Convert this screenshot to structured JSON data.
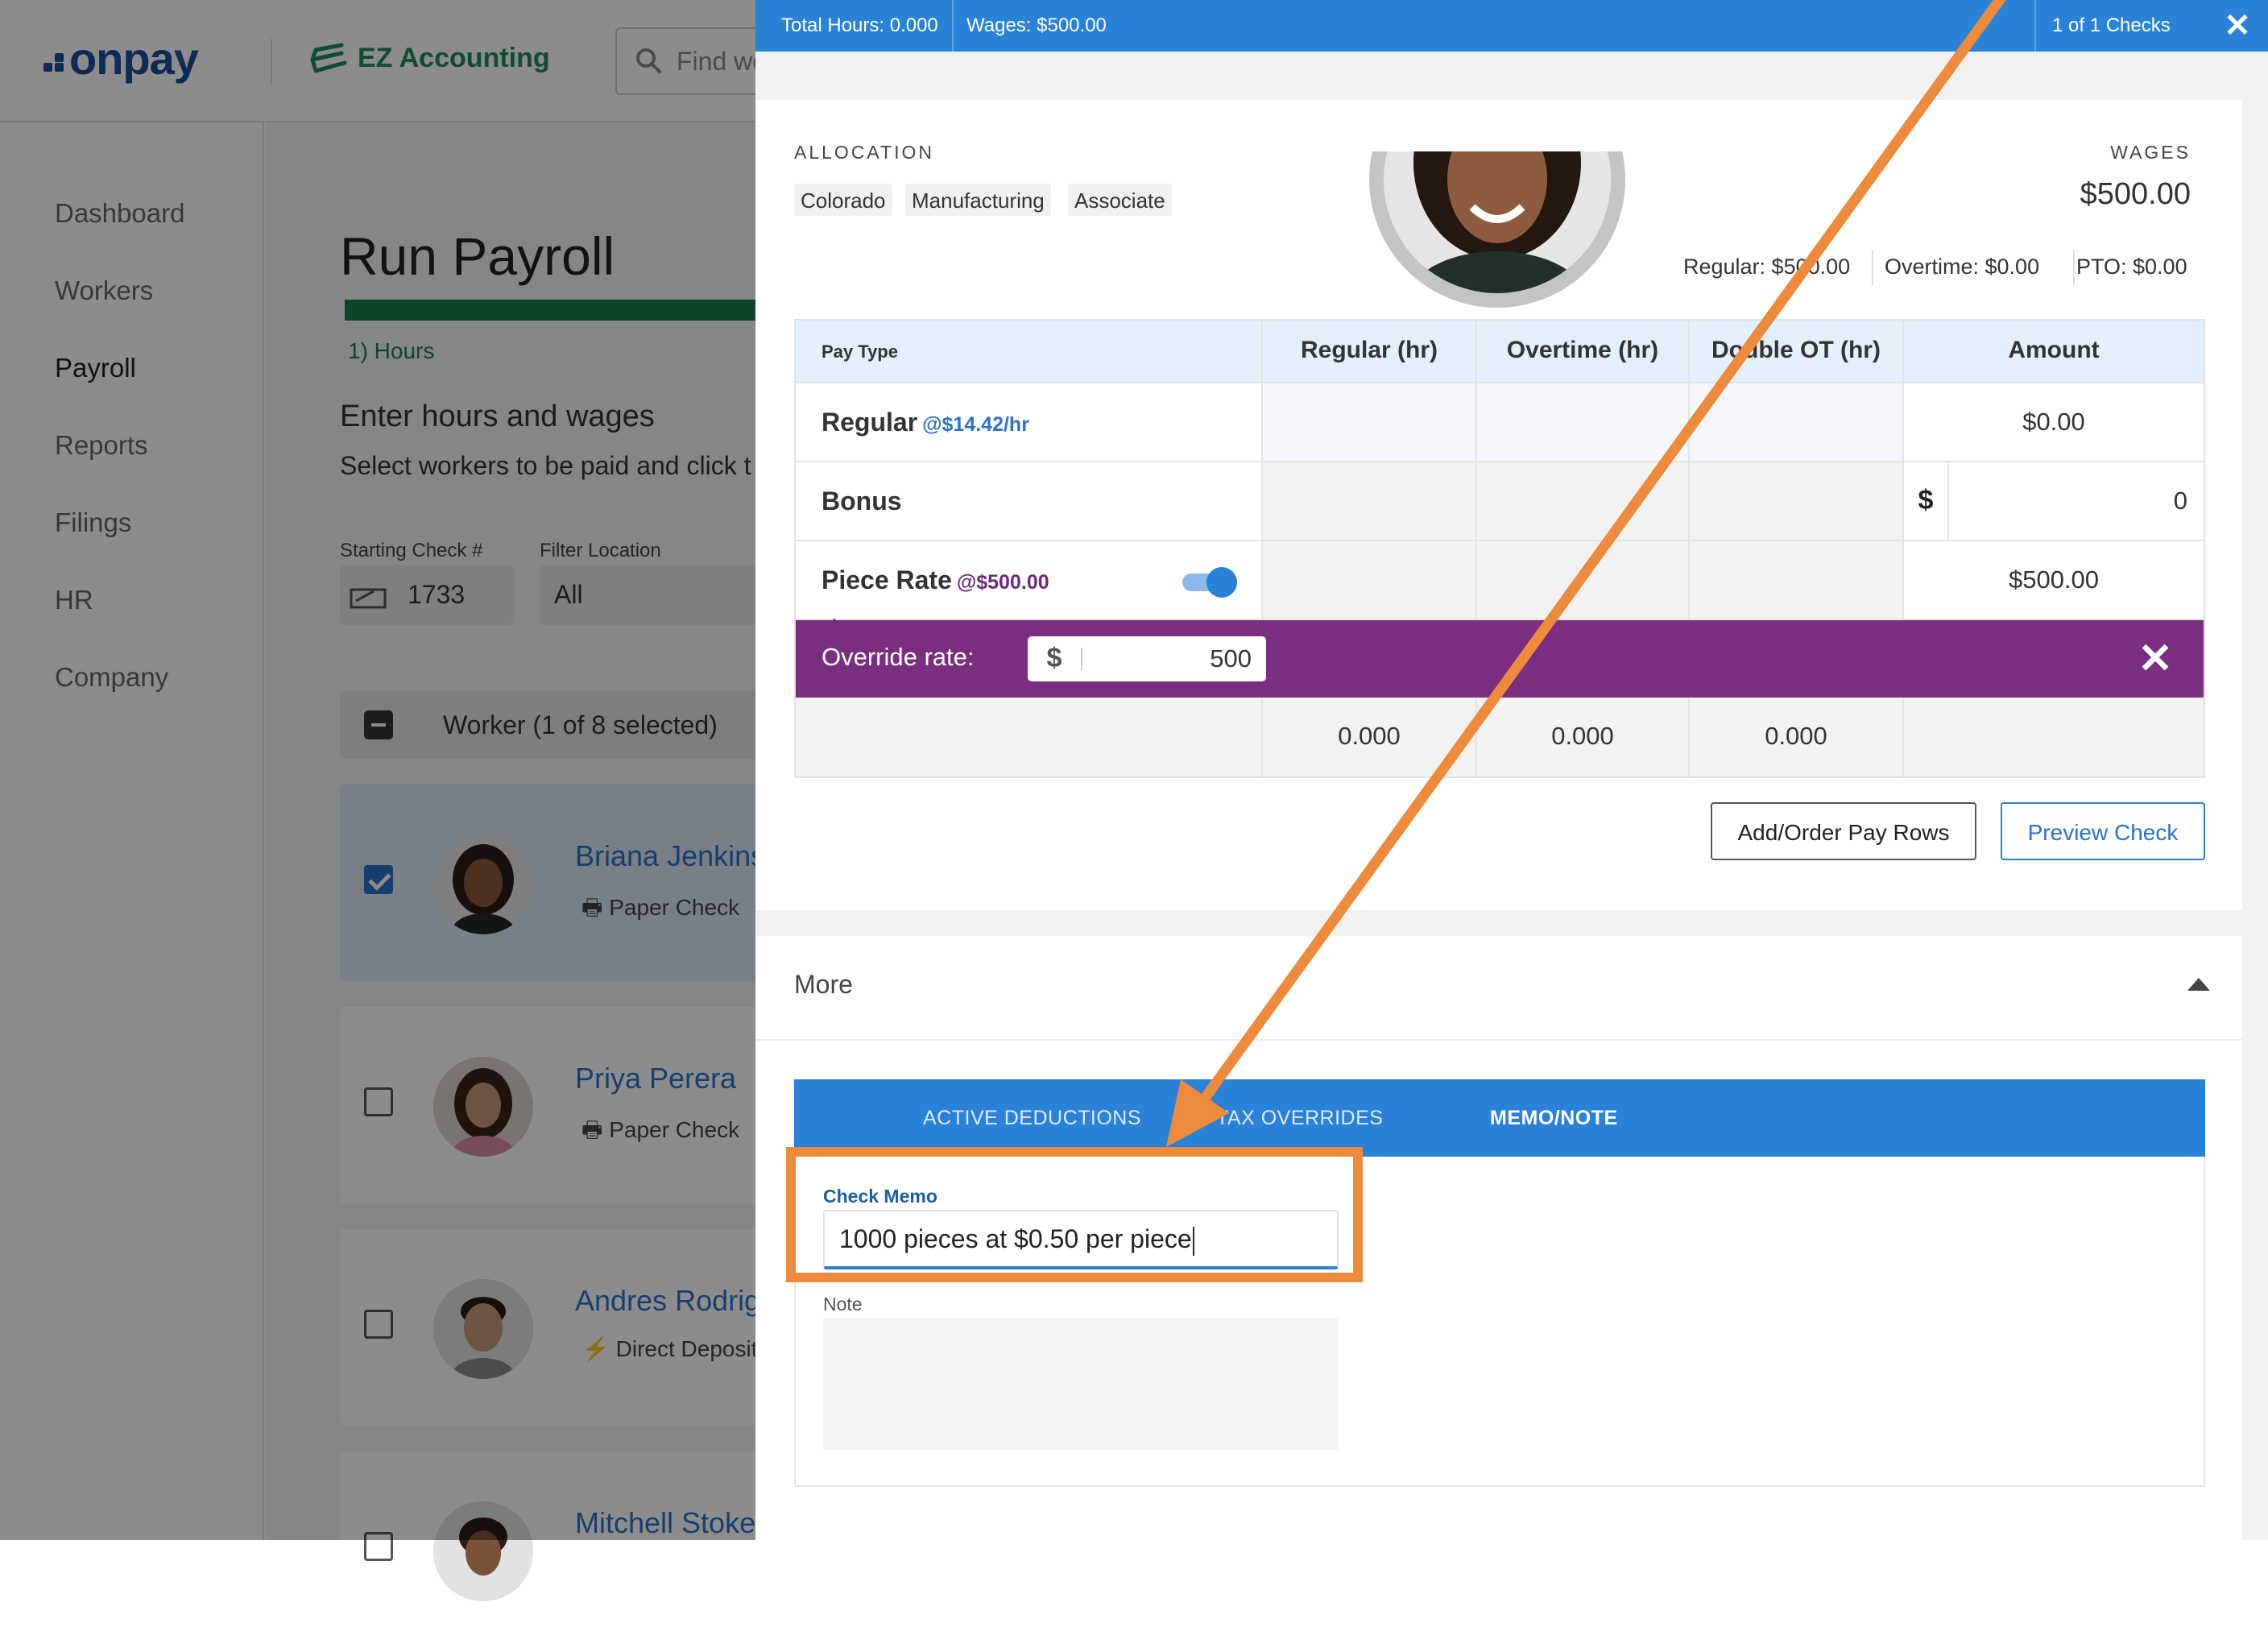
{
  "app": {
    "logo": "onpay",
    "company": "EZ Accounting",
    "search_placeholder": "Find wo"
  },
  "sidebar": {
    "items": [
      {
        "label": "Dashboard"
      },
      {
        "label": "Workers"
      },
      {
        "label": "Payroll"
      },
      {
        "label": "Reports"
      },
      {
        "label": "Filings"
      },
      {
        "label": "HR"
      },
      {
        "label": "Company"
      }
    ],
    "active": "Payroll"
  },
  "page": {
    "title": "Run Payroll",
    "step": "1) Hours",
    "subtitle": "Enter hours and wages",
    "instruction": "Select workers to be paid and click t",
    "starting_check_label": "Starting Check #",
    "starting_check_value": "1733",
    "filter_location_label": "Filter Location",
    "filter_location_value": "All",
    "worker_header": "Worker (1 of 8 selected)",
    "workers": [
      {
        "name": "Briana Jenkins",
        "pay_method": "Paper Check",
        "selected": true
      },
      {
        "name": "Priya Perera",
        "pay_method": "Paper Check",
        "selected": false
      },
      {
        "name": "Andres Rodrig",
        "pay_method": "Direct Deposit",
        "selected": false
      },
      {
        "name": "Mitchell Stoke",
        "pay_method": "",
        "selected": false
      }
    ]
  },
  "panel": {
    "total_hours": "Total Hours: 0.000",
    "wages": "Wages: $500.00",
    "checks": "1 of 1 Checks",
    "allocation_label": "ALLOCATION",
    "allocation_tags": [
      "Colorado",
      "Manufacturing",
      "Associate"
    ],
    "wages_label": "WAGES",
    "wages_value": "$500.00",
    "breakdown": {
      "regular": "Regular: $500.00",
      "overtime": "Overtime: $0.00",
      "pto": "PTO: $0.00"
    },
    "table": {
      "headers": [
        "Pay Type",
        "Regular (hr)",
        "Overtime (hr)",
        "Double OT (hr)",
        "Amount"
      ],
      "rows": [
        {
          "type": "Regular",
          "rate": "@$14.42/hr",
          "amount": "$0.00"
        },
        {
          "type": "Bonus",
          "currency": "$",
          "value": "0"
        },
        {
          "type": "Piece Rate",
          "rate": "@$500.00",
          "toggle_on": true,
          "amount": "$500.00"
        }
      ],
      "override": {
        "label": "Override rate:",
        "currency": "$",
        "value": "500"
      },
      "totals": [
        "0.000",
        "0.000",
        "0.000"
      ]
    },
    "buttons": {
      "add_rows": "Add/Order Pay Rows",
      "preview": "Preview Check"
    },
    "more": {
      "title": "More",
      "tabs": [
        "ACTIVE DEDUCTIONS",
        "TAX OVERRIDES",
        "MEMO/NOTE"
      ],
      "active_tab": "MEMO/NOTE",
      "check_memo_label": "Check Memo",
      "check_memo_value": "1000 pieces at $0.50 per piece",
      "note_label": "Note"
    }
  },
  "colors": {
    "brand_blue": "#2a82d8",
    "override_purple": "#7a2e7f",
    "annotation_orange": "#ee8a3c",
    "progress_green": "#1a7f4e"
  }
}
